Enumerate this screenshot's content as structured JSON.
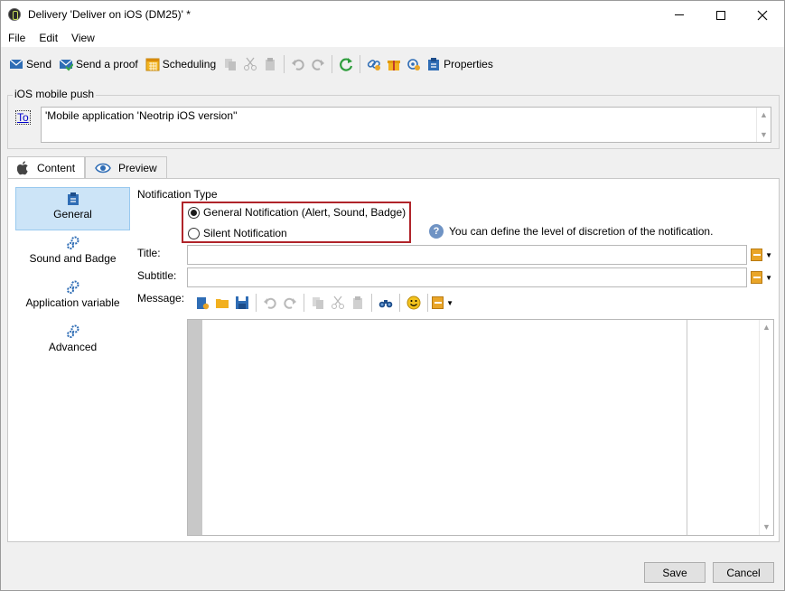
{
  "window": {
    "title": "Delivery 'Deliver on iOS (DM25)' *",
    "minimize": "—",
    "maximize": "☐",
    "close": "✕"
  },
  "menu": [
    "File",
    "Edit",
    "View"
  ],
  "toolbar": {
    "send_label": "Send",
    "send_proof_label": "Send a proof",
    "scheduling_label": "Scheduling",
    "properties_label": "Properties"
  },
  "group": {
    "label": "iOS mobile push",
    "to_link": "To",
    "to_value": "'Mobile application 'Neotrip iOS version''"
  },
  "tabs": [
    {
      "label": "Content",
      "icon": "apple-icon"
    },
    {
      "label": "Preview",
      "icon": "eye-icon"
    }
  ],
  "nav": [
    {
      "label": "General",
      "icon": "clipboard-icon",
      "active": true
    },
    {
      "label": "Sound and Badge",
      "icon": "gears-icon"
    },
    {
      "label": "Application variable",
      "icon": "gears-icon"
    },
    {
      "label": "Advanced",
      "icon": "gears-icon"
    }
  ],
  "form": {
    "notification_type_label": "Notification Type",
    "option_general": "General Notification (Alert, Sound, Badge)",
    "option_silent": "Silent Notification",
    "help_text": "You can define the level of discretion of the notification.",
    "title_label": "Title:",
    "subtitle_label": "Subtitle:",
    "message_label": "Message:"
  },
  "buttons": {
    "save": "Save",
    "cancel": "Cancel"
  },
  "colors": {
    "highlight_border": "#b0242a",
    "nav_active": "#cce4f7",
    "link": "#0000cc"
  }
}
